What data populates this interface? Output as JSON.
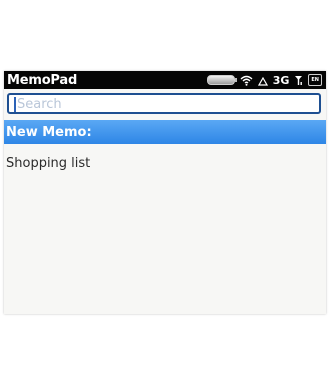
{
  "app": {
    "title": "MemoPad"
  },
  "status": {
    "network": "3G",
    "input_language": "EN"
  },
  "search": {
    "placeholder": "Search"
  },
  "list": {
    "items": [
      {
        "label": "New Memo:"
      },
      {
        "label": "Shopping list"
      }
    ]
  },
  "colors": {
    "selection": "#3a95ec",
    "title_bar": "#050505",
    "search_border": "#1e4f91"
  },
  "icons": [
    "battery-icon",
    "wifi-icon",
    "alert-triangle-icon",
    "signal-icon",
    "input-language-icon"
  ]
}
